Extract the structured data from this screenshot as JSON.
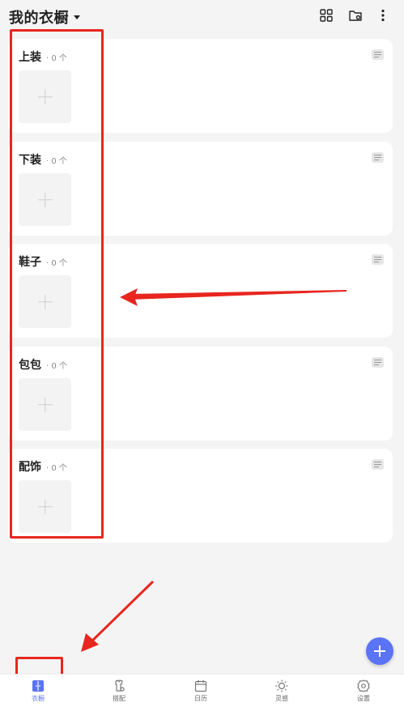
{
  "header": {
    "title": "我的衣橱",
    "icons": [
      "grid-icon",
      "folder-settings-icon",
      "more-vertical-icon"
    ]
  },
  "categories": [
    {
      "name": "上装",
      "count": "· 0 个"
    },
    {
      "name": "下装",
      "count": "· 0 个"
    },
    {
      "name": "鞋子",
      "count": "· 0 个"
    },
    {
      "name": "包包",
      "count": "· 0 个"
    },
    {
      "name": "配饰",
      "count": "· 0 个"
    }
  ],
  "tabs": [
    {
      "label": "衣橱",
      "icon": "wardrobe-icon",
      "active": true
    },
    {
      "label": "搭配",
      "icon": "outfit-icon",
      "active": false
    },
    {
      "label": "日历",
      "icon": "calendar-icon",
      "active": false
    },
    {
      "label": "灵感",
      "icon": "inspiration-icon",
      "active": false
    },
    {
      "label": "设置",
      "icon": "settings-icon",
      "active": false
    }
  ],
  "colors": {
    "accent": "#5b73f5",
    "annotation": "#e8261f",
    "background": "#f4f4f4"
  }
}
